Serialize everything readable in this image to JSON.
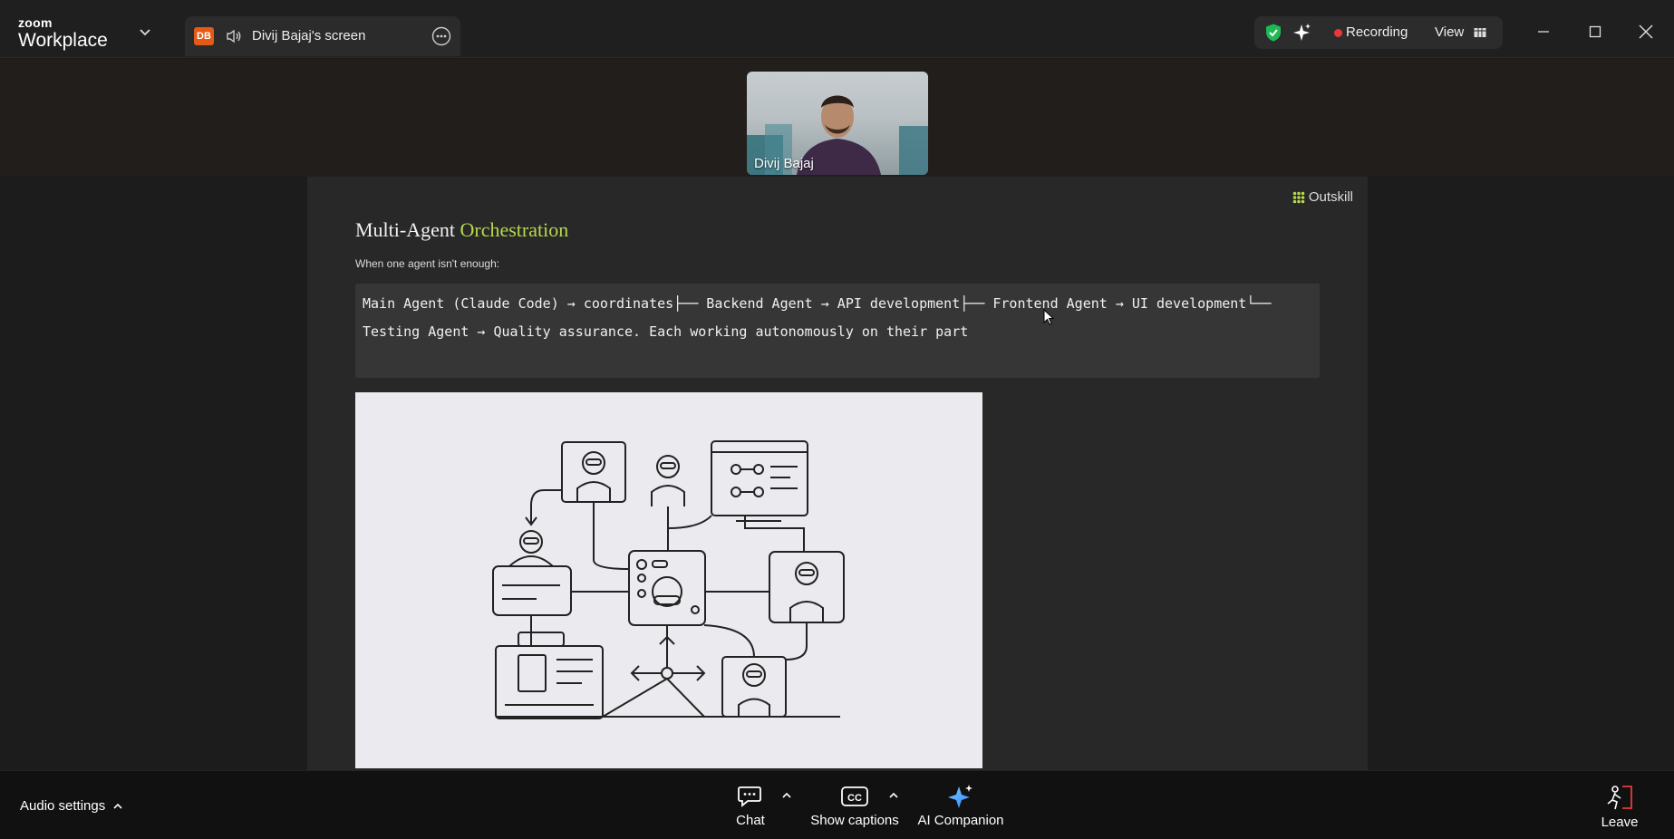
{
  "app": {
    "logo_top": "zoom",
    "logo_bottom": "Workplace"
  },
  "share_tab": {
    "badge": "DB",
    "label": "Divij Bajaj's screen"
  },
  "status": {
    "recording_label": "Recording",
    "view_label": "View",
    "recording_color": "#e8383a",
    "shield_color": "#1db954"
  },
  "participant": {
    "name": "Divij Bajaj"
  },
  "slide": {
    "brand": "Outskill",
    "title_main": "Multi-Agent",
    "title_accent": "Orchestration",
    "accent_color": "#b6d94c",
    "subtitle": "When one agent isn't enough:",
    "code_lines": [
      "Main Agent (Claude Code) → coordinates├── Backend Agent → API development├── Frontend Agent → UI development└──",
      "Testing Agent → Quality assurance. Each working autonomously on their part"
    ]
  },
  "toolbar": {
    "audio_label": "Audio settings",
    "chat_label": "Chat",
    "captions_label": "Show captions",
    "ai_label": "AI Companion",
    "leave_label": "Leave",
    "captions_icon_text": "CC"
  }
}
